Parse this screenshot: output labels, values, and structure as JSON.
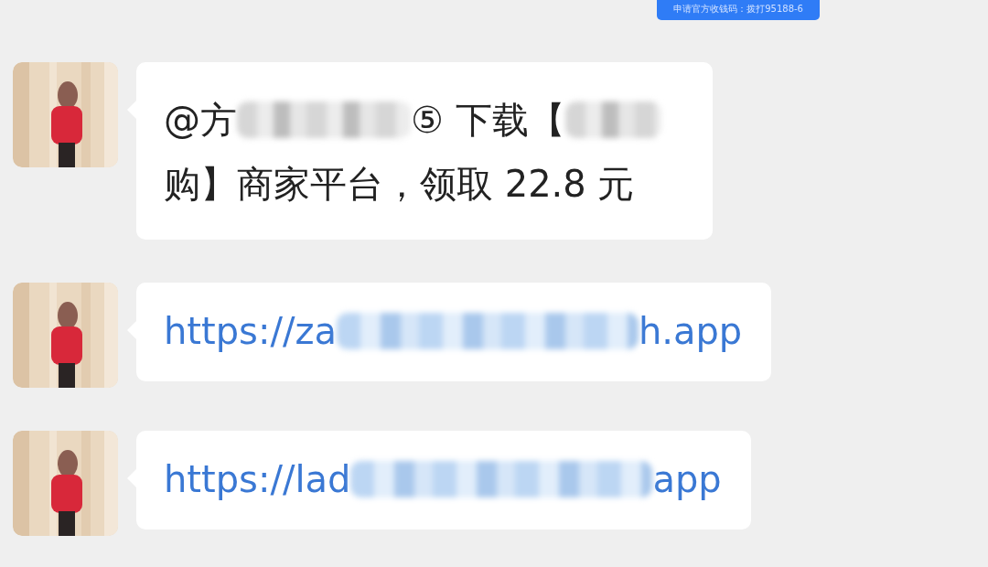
{
  "top_message": {
    "text": "申请官方收钱码：拨打95188-6"
  },
  "messages": [
    {
      "kind": "text",
      "parts": [
        {
          "kind": "text",
          "text": "@方"
        },
        {
          "kind": "blur"
        },
        {
          "kind": "text",
          "text": "⑤ 下载【"
        },
        {
          "kind": "blur"
        },
        {
          "kind": "text",
          "text": "购】商家平台，领取 22.8 元"
        }
      ]
    },
    {
      "kind": "link",
      "parts": [
        {
          "kind": "text",
          "text": "https://za"
        },
        {
          "kind": "blur"
        },
        {
          "kind": "text",
          "text": "h.app"
        }
      ]
    },
    {
      "kind": "link",
      "parts": [
        {
          "kind": "text",
          "text": "https://lad"
        },
        {
          "kind": "blur"
        },
        {
          "kind": "text",
          "text": "app"
        }
      ]
    }
  ]
}
